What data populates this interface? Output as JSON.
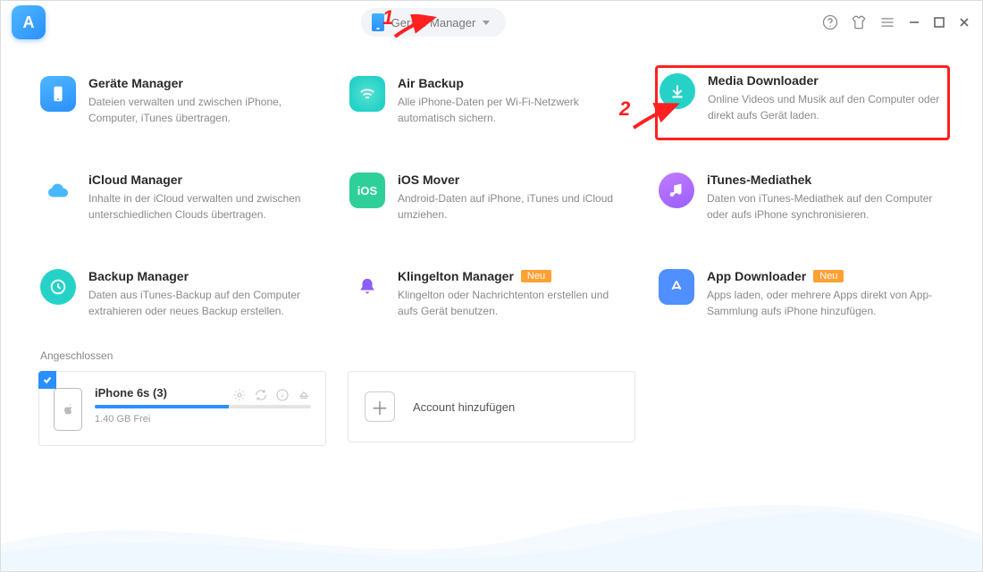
{
  "header": {
    "mode_label": "Geräte Manager"
  },
  "tiles": {
    "device_manager": {
      "title": "Geräte Manager",
      "desc": "Dateien verwalten und zwischen iPhone, Computer, iTunes übertragen."
    },
    "air_backup": {
      "title": "Air Backup",
      "desc": "Alle iPhone-Daten per Wi-Fi-Netzwerk automatisch sichern."
    },
    "media_downloader": {
      "title": "Media Downloader",
      "desc": "Online Videos und Musik auf den Computer oder direkt aufs Gerät laden."
    },
    "icloud_manager": {
      "title": "iCloud Manager",
      "desc": "Inhalte in der iCloud verwalten und zwischen unterschiedlichen Clouds übertragen."
    },
    "ios_mover": {
      "title": "iOS Mover",
      "desc": "Android-Daten auf iPhone, iTunes und iCloud umziehen."
    },
    "itunes_media": {
      "title": "iTunes-Mediathek",
      "desc": "Daten von iTunes-Mediathek auf den Computer oder aufs iPhone synchronisieren."
    },
    "backup_manager": {
      "title": "Backup Manager",
      "desc": "Daten aus iTunes-Backup auf den Computer extrahieren oder neues Backup erstellen."
    },
    "ringtone": {
      "title": "Klingelton Manager",
      "desc": "Klingelton oder Nachrichtenton erstellen und aufs Gerät benutzen."
    },
    "app_downloader": {
      "title": "App Downloader",
      "desc": "Apps laden, oder mehrere Apps direkt von App-Sammlung aufs iPhone hinzufügen."
    }
  },
  "badges": {
    "neu": "Neu"
  },
  "connected": {
    "section_label": "Angeschlossen",
    "device_name": "iPhone 6s (3)",
    "free_text": "1.40 GB Frei"
  },
  "add_account_label": "Account hinzufügen",
  "annotations": {
    "step1": "1",
    "step2": "2"
  },
  "colors": {
    "blue": "#2a8fff",
    "cyan": "#26d2c7",
    "purple": "#9a5fff",
    "green": "#2fcf9a",
    "red": "#ff2020",
    "orange": "#ffa033",
    "bell": "#8a5fff"
  }
}
